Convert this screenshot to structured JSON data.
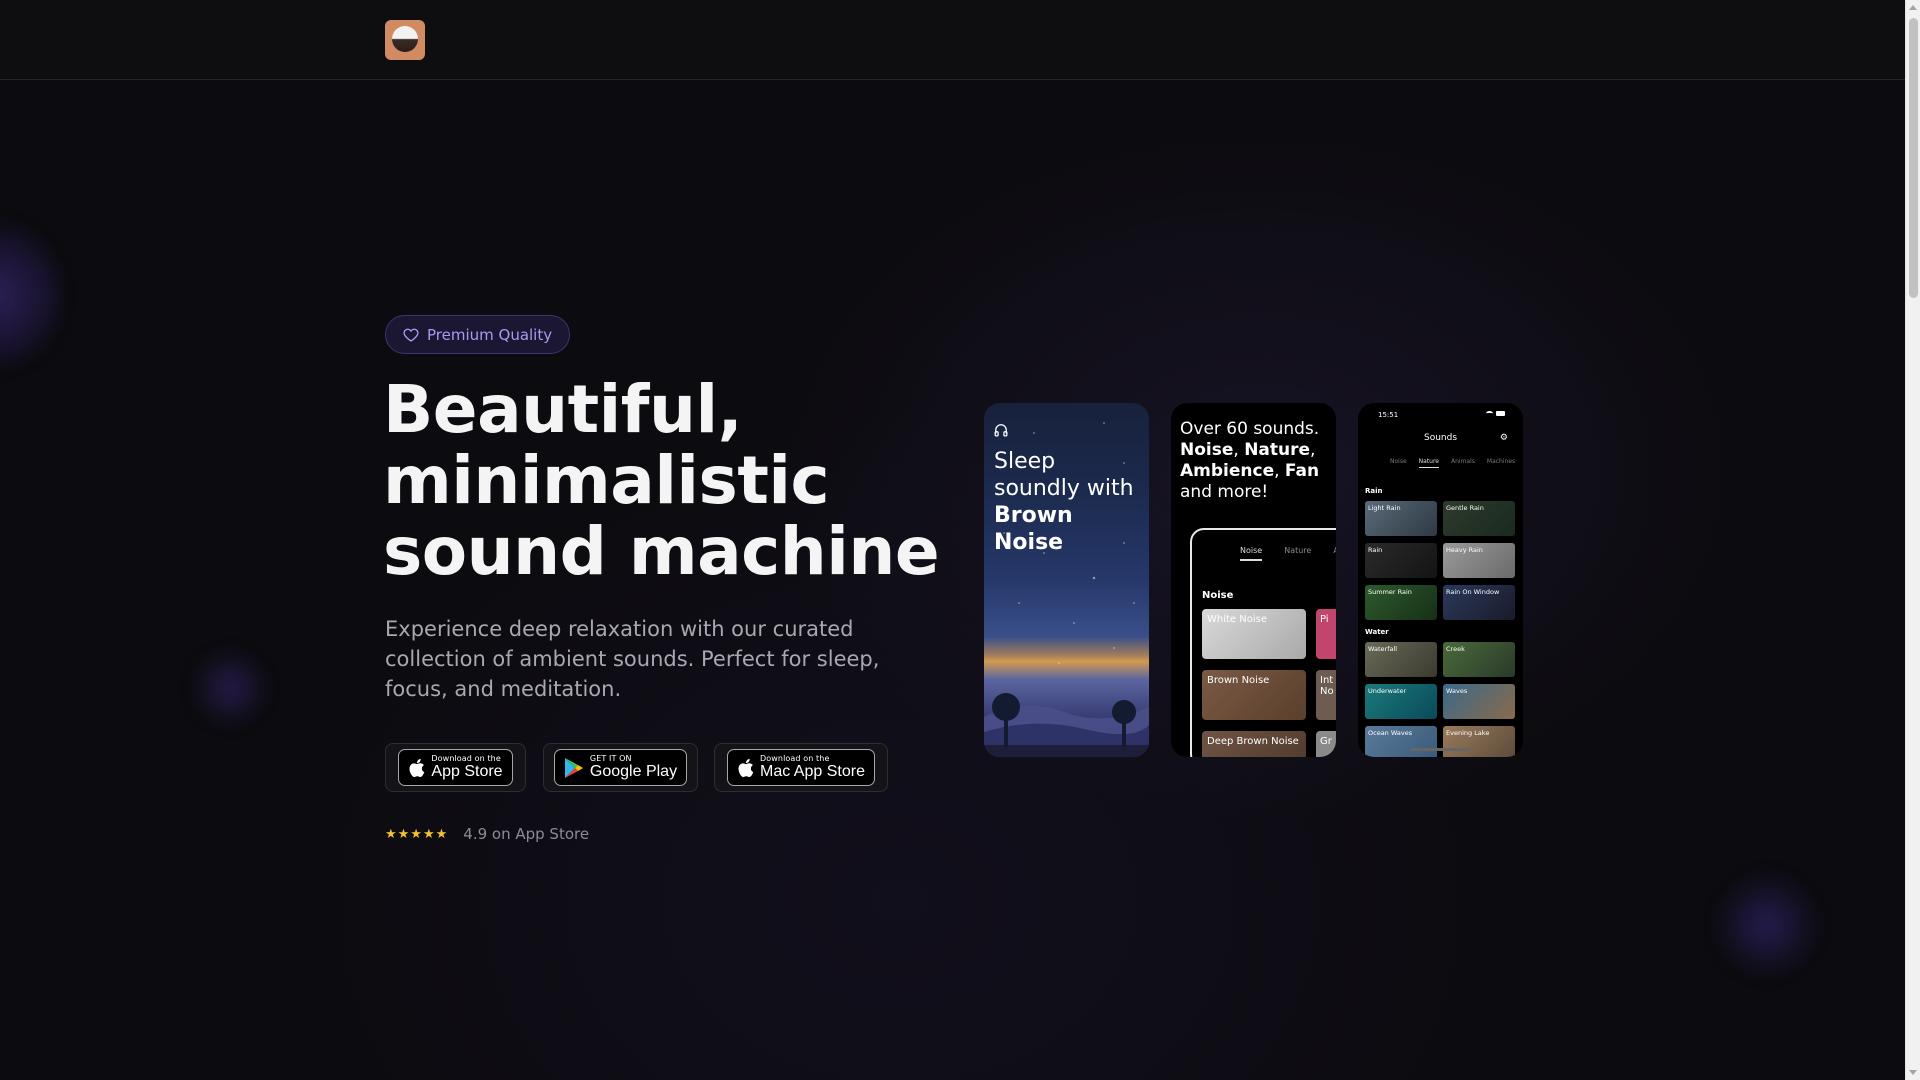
{
  "colors": {
    "background": "#0c0b0f",
    "accent_purple": "#a99bf0",
    "star_gold": "#f2c230"
  },
  "header": {
    "logo_icon": "sound-machine-logo-icon"
  },
  "hero": {
    "badge": {
      "icon": "heart-icon",
      "label": "Premium Quality"
    },
    "headline": "Beautiful, minimalistic sound machine",
    "subtext": "Experience deep relaxation with our curated collection of ambient sounds. Perfect for sleep, focus, and meditation.",
    "store_buttons": [
      {
        "small": "Download on the",
        "big": "App Store",
        "icon": "apple-icon"
      },
      {
        "small": "GET IT ON",
        "big": "Google Play",
        "icon": "google-play-icon"
      },
      {
        "small": "Download on the",
        "big": "Mac App Store",
        "icon": "apple-icon"
      }
    ],
    "rating": {
      "stars": "★★★★★",
      "star_count": 5,
      "text": "4.9 on App Store"
    }
  },
  "screenshots": {
    "phone1": {
      "icon": "headphones-icon",
      "line1": "Sleep",
      "line2": "soundly with",
      "bold": "Brown Noise"
    },
    "phone2": {
      "line1": "Over 60 sounds.",
      "bold1": "Noise",
      "sep1": ", ",
      "bold2": "Nature",
      "sep2": ",",
      "bold3": "Ambience",
      "sep3": ", ",
      "bold4": "Fan",
      "line4": "and more!",
      "tabs": [
        "Noise",
        "Nature",
        "A"
      ],
      "section": "Noise",
      "tiles": [
        "White Noise",
        "Brown Noise",
        "Deep Brown Noise"
      ],
      "side_tiles": [
        "Pi",
        "Int No",
        "Gr"
      ]
    },
    "phone3": {
      "time": "15:51",
      "title": "Sounds",
      "tabs": [
        "Noise",
        "Nature",
        "Animals",
        "Machines"
      ],
      "sections": [
        {
          "name": "Rain",
          "tiles": [
            "Light Rain",
            "Gentle Rain",
            "Rain",
            "Heavy Rain",
            "Summer Rain",
            "Rain On Window"
          ]
        },
        {
          "name": "Water",
          "tiles": [
            "Waterfall",
            "Creek",
            "Underwater",
            "Waves",
            "Ocean Waves",
            "Evening Lake"
          ]
        }
      ]
    }
  }
}
